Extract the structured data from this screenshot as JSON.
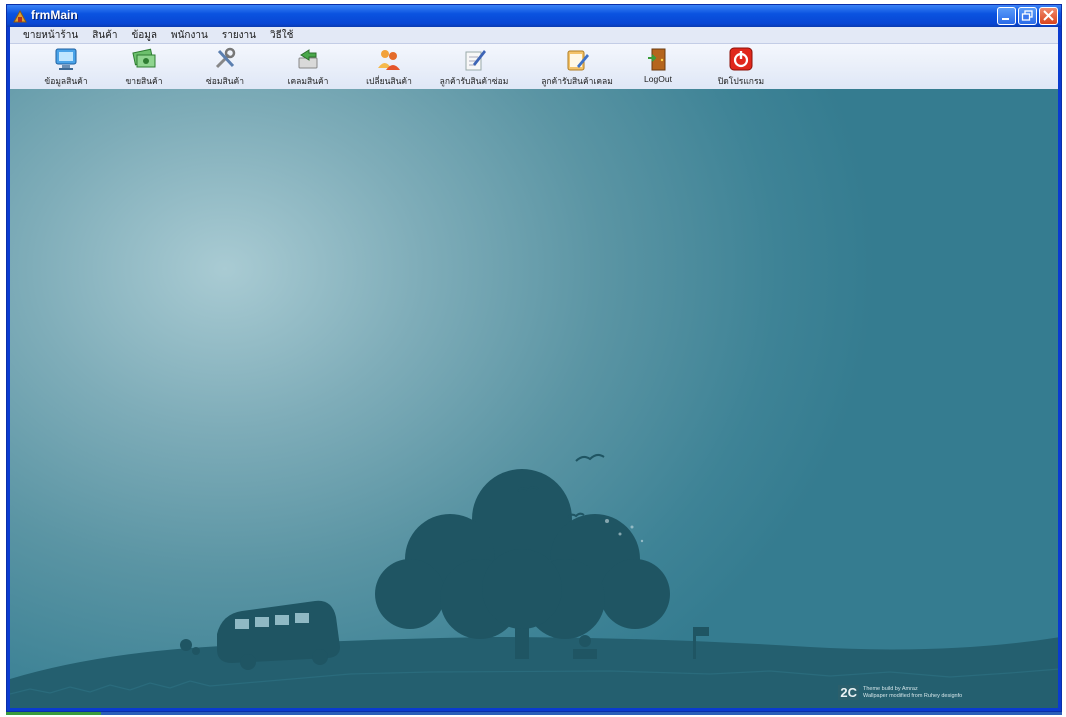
{
  "window": {
    "title": "frmMain"
  },
  "menu": [
    "ขายหน้าร้าน",
    "สินค้า",
    "ข้อมูล",
    "พนักงาน",
    "รายงาน",
    "วิธีใช้"
  ],
  "toolbar": [
    {
      "label": "ข้อมูลสินค้า",
      "icon": "monitor-icon"
    },
    {
      "label": "ขายสินค้า",
      "icon": "money-icon"
    },
    {
      "label": "ซ่อมสินค้า",
      "icon": "tools-icon"
    },
    {
      "label": "เคลมสินค้า",
      "icon": "exchange-icon"
    },
    {
      "label": "เปลี่ยนสินค้า",
      "icon": "people-icon"
    },
    {
      "label": "ลูกค้ารับสินค้าซ่อม",
      "icon": "pen-document-icon"
    },
    {
      "label": "ลูกค้ารับสินค้าเคลม",
      "icon": "notepad-icon"
    },
    {
      "label": "LogOut",
      "icon": "logout-door-icon"
    },
    {
      "label": "ปิดโปรแกรม",
      "icon": "power-icon"
    }
  ],
  "wallpaper": {
    "credit_logo": "2C",
    "credit_line1": "Theme build by Amraz",
    "credit_line2": "Wallpaper modified from Ruhey designfo"
  },
  "colors": {
    "titlebar": "#0a53e0",
    "desktop": "#3b8296",
    "silhouette": "#1f5563"
  }
}
